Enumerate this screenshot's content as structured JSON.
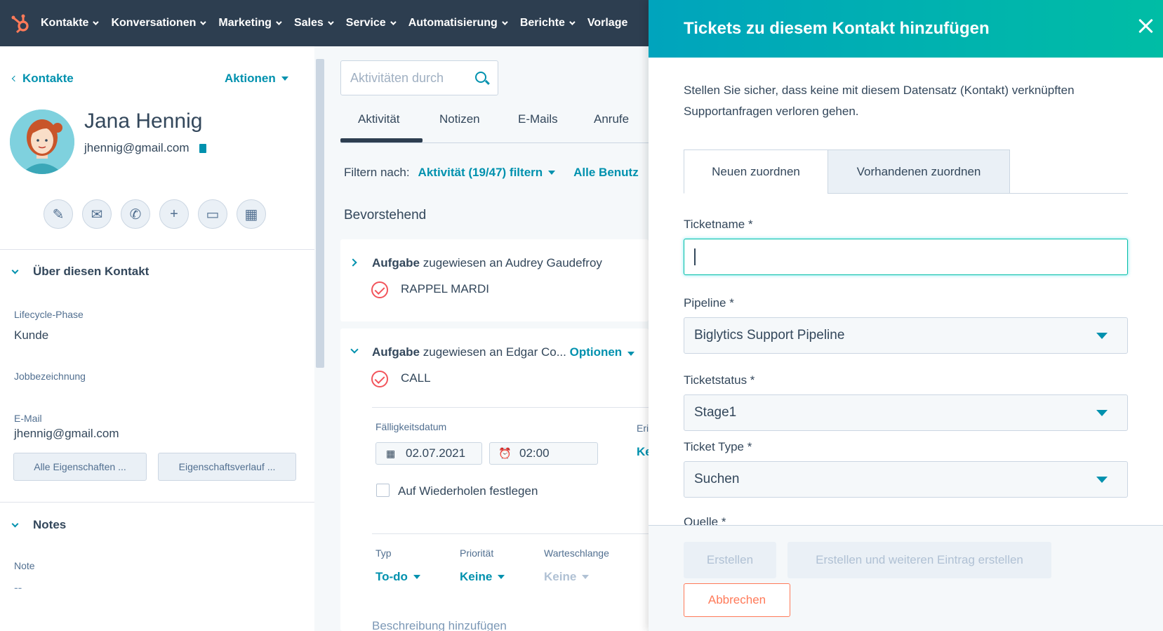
{
  "topnav": {
    "items": [
      "Kontakte",
      "Konversationen",
      "Marketing",
      "Sales",
      "Service",
      "Automatisierung",
      "Berichte",
      "Vorlage"
    ]
  },
  "contact": {
    "back_label": "Kontakte",
    "actions_label": "Aktionen",
    "name": "Jana Hennig",
    "email": "jhennig@gmail.com"
  },
  "about": {
    "title": "Über diesen Kontakt",
    "lifecycle_label": "Lifecycle-Phase",
    "lifecycle_value": "Kunde",
    "job_label": "Jobbezeichnung",
    "email_label": "E-Mail",
    "email_value": "jhennig@gmail.com",
    "btn_all": "Alle Eigenschaften ...",
    "btn_history": "Eigenschaftsverlauf ..."
  },
  "notes": {
    "title": "Notes",
    "note_label": "Note",
    "note_value": "--"
  },
  "activity": {
    "search_placeholder": "Aktivitäten durch",
    "tabs": [
      "Aktivität",
      "Notizen",
      "E-Mails",
      "Anrufe"
    ],
    "filter_label": "Filtern nach:",
    "filter_value": "Aktivität (19/47) filtern",
    "filter_users": "Alle Benutz",
    "upcoming": "Bevorstehend",
    "task1": {
      "kind": "Aufgabe",
      "assigned": "zugewiesen an Audrey Gaudefroy",
      "title": "RAPPEL MARDI"
    },
    "task2": {
      "kind": "Aufgabe",
      "assigned": "zugewiesen an Edgar Co...",
      "options": "Optionen",
      "title": "CALL",
      "due_label": "Fälligkeitsdatum",
      "due_date": "02.07.2021",
      "due_time": "02:00",
      "reminder_cut": "Eri",
      "reminder_val_cut": "Ke",
      "repeat_label": "Auf Wiederholen festlegen",
      "type_label": "Typ",
      "type_value": "To-do",
      "priority_label": "Priorität",
      "priority_value": "Keine",
      "queue_label": "Warteschlange",
      "queue_value": "Keine",
      "description": "Beschreibung hinzufügen"
    }
  },
  "panel": {
    "title": "Tickets zu diesem Kontakt hinzufügen",
    "description": "Stellen Sie sicher, dass keine mit diesem Datensatz (Kontakt) verknüpften Supportanfragen verloren gehen.",
    "tab_new": "Neuen zuordnen",
    "tab_existing": "Vorhandenen zuordnen",
    "ticketname_label": "Ticketname *",
    "ticketname_value": "",
    "pipeline_label": "Pipeline *",
    "pipeline_value": "Biglytics Support Pipeline",
    "status_label": "Ticketstatus *",
    "status_value": "Stage1",
    "type_label": "Ticket Type *",
    "type_value": "Suchen",
    "source_label_cut": "Quelle *",
    "btn_create": "Erstellen",
    "btn_create_another": "Erstellen und weiteren Eintrag erstellen",
    "btn_cancel": "Abbrechen"
  },
  "colors": {
    "nav_bg": "#2d3e50",
    "accent": "#0091ae",
    "header_gradient_start": "#00a4bd",
    "header_gradient_end": "#00bda5",
    "cancel": "#ff7a59",
    "task_check": "#f2545b"
  }
}
